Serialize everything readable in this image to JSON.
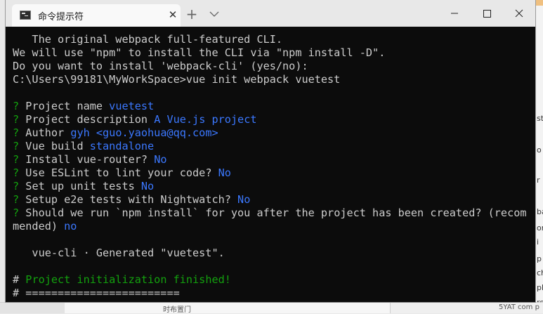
{
  "window": {
    "tab_title": "命令提示符",
    "tab_close": "✕",
    "new_tab": "+",
    "icons": [
      "cmd-icon",
      "close-icon",
      "plus-icon",
      "chevron-down-icon",
      "minimize-icon",
      "maximize-icon",
      "close-icon"
    ]
  },
  "terminal": {
    "intro": [
      "   The original webpack full-featured CLI.",
      "We will use \"npm\" to install the CLI via \"npm install -D\".",
      "Do you want to install 'webpack-cli' (yes/no):",
      "C:\\Users\\99181\\MyWorkSpace>vue init webpack vuetest"
    ],
    "prompts": [
      {
        "mark": "?",
        "question": " Project name ",
        "answer": "vuetest"
      },
      {
        "mark": "?",
        "question": " Project description ",
        "answer": "A Vue.js project"
      },
      {
        "mark": "?",
        "question": " Author ",
        "answer": "gyh <guo.yaohua@qq.com>"
      },
      {
        "mark": "?",
        "question": " Vue build ",
        "answer": "standalone"
      },
      {
        "mark": "?",
        "question": " Install vue-router? ",
        "answer": "No"
      },
      {
        "mark": "?",
        "question": " Use ESLint to lint your code? ",
        "answer": "No"
      },
      {
        "mark": "?",
        "question": " Set up unit tests ",
        "answer": "No"
      },
      {
        "mark": "?",
        "question": " Setup e2e tests with Nightwatch? ",
        "answer": "No"
      }
    ],
    "last_prompt": {
      "mark": "?",
      "question_line1": " Should we run `npm install` for you after the project has been created? (recom",
      "question_line2": "mended) ",
      "answer": "no"
    },
    "generated": "   vue-cli · Generated \"vuetest\".",
    "finish_hash": "# ",
    "finish_text": "Project initialization finished!",
    "divider": "# ========================"
  },
  "background": {
    "right_fragments": [
      "st",
      "o",
      "r",
      "ba",
      "on",
      "i",
      "p",
      "ch",
      "pl",
      "ro",
      "e"
    ],
    "bottom_fragments": [
      "时布置门",
      "5YAT com p"
    ]
  },
  "colors": {
    "terminal_bg": "#0c0c0c",
    "text": "#cccccc",
    "green": "#13a10e",
    "blue": "#3b78ff",
    "titlebar": "#e8e8e8"
  }
}
